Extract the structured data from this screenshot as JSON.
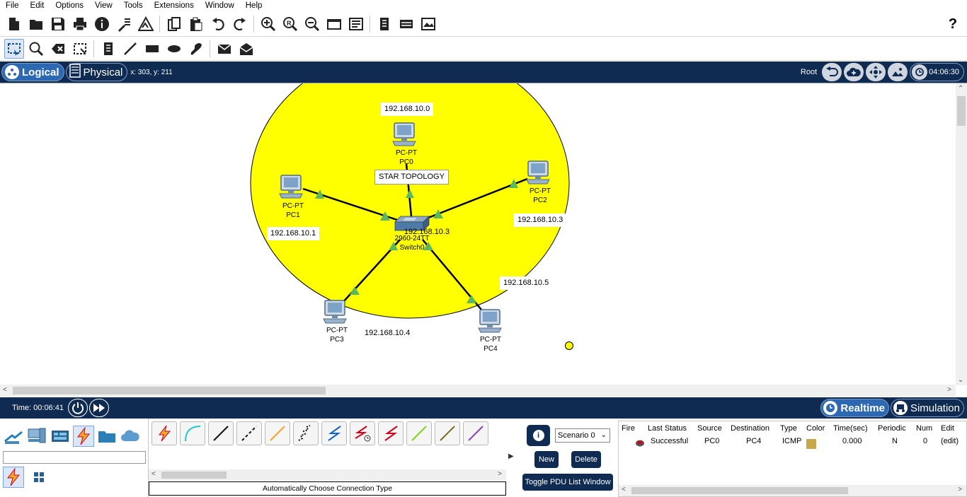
{
  "menu": [
    "File",
    "Edit",
    "Options",
    "View",
    "Tools",
    "Extensions",
    "Window",
    "Help"
  ],
  "toolbar": {
    "main_icons": [
      "new-icon",
      "open-icon",
      "save-icon",
      "print-icon",
      "info-icon",
      "network-wizard-icon",
      "activity-wizard-icon",
      "copy-icon",
      "paste-icon",
      "undo-icon",
      "redo-icon",
      "zoom-in-icon",
      "zoom-reset-icon",
      "zoom-out-icon",
      "drawing-palette-icon",
      "custom-device-icon",
      "pdu-icon",
      "cluster-icon",
      "screenshot-icon"
    ],
    "help_label": "?",
    "edit_icons": [
      "select-icon",
      "inspect-icon",
      "delete-icon",
      "resize-icon",
      "note-icon",
      "draw-line-icon",
      "rectangle-icon",
      "ellipse-icon",
      "freeform-icon",
      "simple-pdu-icon",
      "complex-pdu-icon"
    ]
  },
  "modebar": {
    "logical_label": "Logical",
    "physical_label": "Physical",
    "coords": "x: 303, y: 211",
    "root_label": "Root",
    "clock": "04:06:30"
  },
  "topology": {
    "title": "STAR TOPOLOGY",
    "fill_color": "#ffff00",
    "link_color": "#000000",
    "port_color": "#5cb85c",
    "switch": {
      "model": "2960-24TT",
      "name": "Switch0",
      "ip_note": "192.168.10.3"
    },
    "pcs": [
      {
        "model": "PC-PT",
        "name": "PC0",
        "ip": "192.168.10.0"
      },
      {
        "model": "PC-PT",
        "name": "PC1",
        "ip": "192.168.10.1"
      },
      {
        "model": "PC-PT",
        "name": "PC2",
        "ip": "192.168.10.3"
      },
      {
        "model": "PC-PT",
        "name": "PC3",
        "ip": "192.168.10.4"
      },
      {
        "model": "PC-PT",
        "name": "PC4",
        "ip": "192.168.10.5"
      }
    ]
  },
  "timebar": {
    "time": "Time: 00:06:41",
    "realtime_label": "Realtime",
    "simulation_label": "Simulation"
  },
  "devices": {
    "categories": [
      "network-devices-icon",
      "end-devices-icon",
      "components-icon",
      "connections-icon",
      "miscellaneous-icon",
      "multiuser-icon"
    ],
    "search_value": "",
    "sub_items": [
      "connections-sub-icon",
      "grid-icon"
    ]
  },
  "connections": {
    "items": [
      "auto-connection-icon",
      "console-cable-icon",
      "copper-straight-icon",
      "copper-cross-icon",
      "fiber-icon",
      "phone-cable-icon",
      "coaxial-icon",
      "serial-dce-icon",
      "serial-dte-icon",
      "octal-cable-icon",
      "iot-cable-icon",
      "usb-cable-icon"
    ],
    "status": "Automatically Choose Connection Type"
  },
  "scenario": {
    "selected": "Scenario 0",
    "new_label": "New",
    "delete_label": "Delete",
    "toggle_label": "Toggle PDU List Window"
  },
  "pdu_table": {
    "headers": [
      "Fire",
      "Last Status",
      "Source",
      "Destination",
      "Type",
      "Color",
      "Time(sec)",
      "Periodic",
      "Num",
      "Edit"
    ],
    "rows": [
      {
        "fire": "",
        "last_status": "Successful",
        "source": "PC0",
        "destination": "PC4",
        "type": "ICMP",
        "color": "#c8a94a",
        "time": "0.000",
        "periodic": "N",
        "num": "0",
        "edit": "(edit)"
      }
    ]
  }
}
